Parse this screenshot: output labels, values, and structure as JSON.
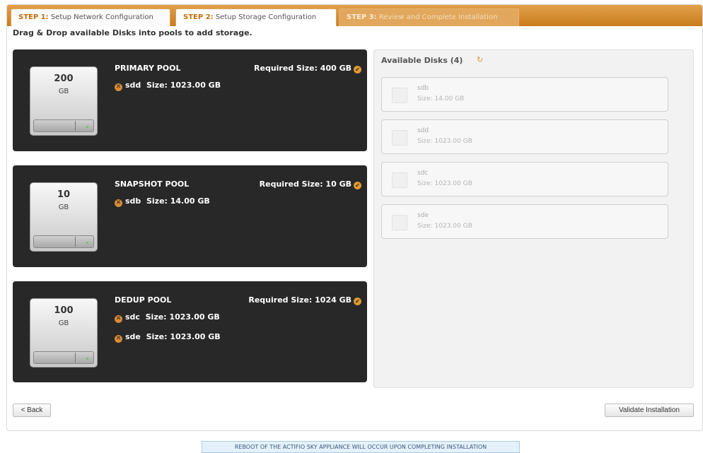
{
  "steps": [
    {
      "num": "STEP 1:",
      "label": "Setup Network Configuration"
    },
    {
      "num": "STEP 2:",
      "label": "Setup Storage Configuration"
    },
    {
      "num": "STEP 3:",
      "label": "Review and Complete Installation"
    }
  ],
  "instructions": "Drag & Drop available Disks into pools to add storage.",
  "pools": [
    {
      "name": "PRIMARY POOL",
      "drive_size": "200",
      "drive_unit": "GB",
      "required": "Required Size: 400 GB",
      "disks": [
        {
          "name": "sdd",
          "size": "Size: 1023.00 GB"
        }
      ]
    },
    {
      "name": "SNAPSHOT POOL",
      "drive_size": "10",
      "drive_unit": "GB",
      "required": "Required Size: 10 GB",
      "disks": [
        {
          "name": "sdb",
          "size": "Size: 14.00 GB"
        }
      ]
    },
    {
      "name": "DEDUP POOL",
      "drive_size": "100",
      "drive_unit": "GB",
      "required": "Required Size: 1024 GB",
      "disks": [
        {
          "name": "sdc",
          "size": "Size: 1023.00 GB"
        },
        {
          "name": "sde",
          "size": "Size: 1023.00 GB"
        }
      ]
    }
  ],
  "available": {
    "title": "Available Disks (4)",
    "disks": [
      {
        "name": "sdb",
        "size_label": "Size:",
        "size": "14.00 GB"
      },
      {
        "name": "sdd",
        "size_label": "Size:",
        "size": "1023.00 GB"
      },
      {
        "name": "sdc",
        "size_label": "Size:",
        "size": "1023.00 GB"
      },
      {
        "name": "sde",
        "size_label": "Size:",
        "size": "1023.00 GB"
      }
    ]
  },
  "buttons": {
    "back": "< Back",
    "validate": "Validate Installation"
  },
  "notice": "REBOOT OF THE ACTIFIO SKY APPLIANCE WILL OCCUR UPON COMPLETING INSTALLATION",
  "icons": {
    "check": "check-circle-icon",
    "remove": "remove-circle-icon",
    "refresh": "refresh-icon",
    "drive": "hard-drive-icon"
  },
  "colors": {
    "accent": "#e09a30",
    "pool_bg": "#282828",
    "notice_bg": "#e4f1fb"
  }
}
